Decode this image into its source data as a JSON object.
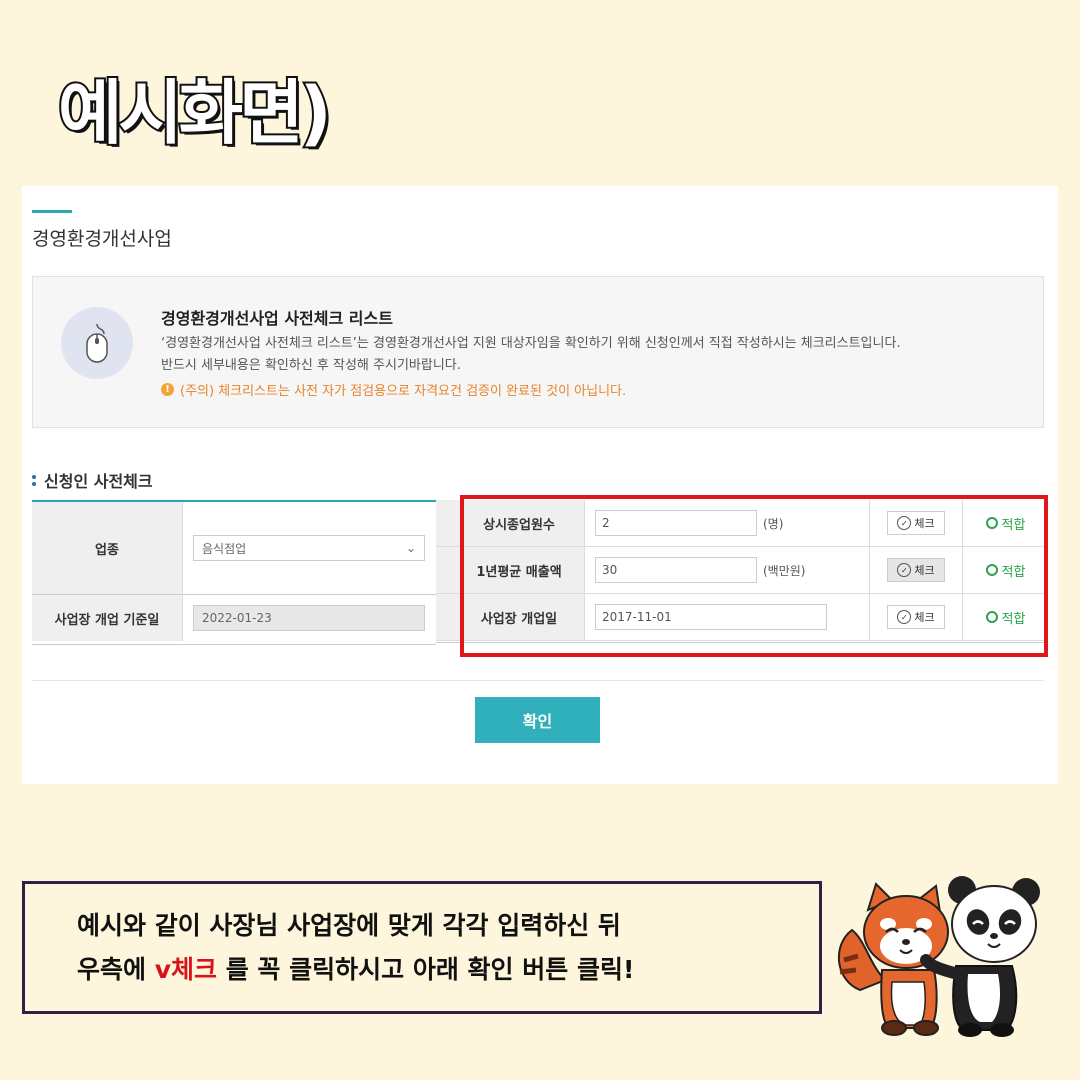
{
  "headline": "예시화면)",
  "panel": {
    "page_title": "경영환경개선사업",
    "info": {
      "title": "경영환경개선사업 사전체크 리스트",
      "desc_line1": "‘경영환경개선사업 사전체크 리스트’는 경영환경개선사업 지원 대상자임을 확인하기 위해 신청인께서 직접 작성하시는 체크리스트입니다.",
      "desc_line2": "반드시 세부내용은 확인하신 후 작성해 주시기바랍니다.",
      "warning": "(주의) 체크리스트는 사전 자가 점검용으로 자격요건 검증이 완료된 것이 아닙니다."
    },
    "section_title": "신청인 사전체크",
    "left_rows": [
      {
        "label": "업종",
        "value": "음식점업"
      },
      {
        "label": "사업장 개업 기준일",
        "value": "2022-01-23"
      }
    ],
    "right_rows": [
      {
        "label": "상시종업원수",
        "value": "2",
        "unit": "(명)",
        "check": "체크",
        "result": "적합"
      },
      {
        "label": "1년평균 매출액",
        "value": "30",
        "unit": "(백만원)",
        "check": "체크",
        "result": "적합"
      },
      {
        "label": "사업장 개업일",
        "value": "2017-11-01",
        "unit": "",
        "check": "체크",
        "result": "적합"
      }
    ],
    "confirm_label": "확인",
    "icons": {
      "info": "mouse-icon",
      "warning": "exclamation-icon",
      "check": "check-circle-icon",
      "result": "circle-ok-icon",
      "select": "chevron-down-icon"
    },
    "colors": {
      "accent": "#2aa7b4",
      "highlight": "#e0161b",
      "ok": "#2aa34a",
      "warning": "#e7842c"
    }
  },
  "instruction": {
    "line1": "예시와 같이 사장님 사업장에 맞게 각각 입력하신 뒤",
    "line2_pre": "우측에 ",
    "line2_highlight": "v체크",
    "line2_post": " 를 꼭 클릭하시고 아래 확인 버튼 클릭!"
  },
  "background_color": "#fdf6dc"
}
